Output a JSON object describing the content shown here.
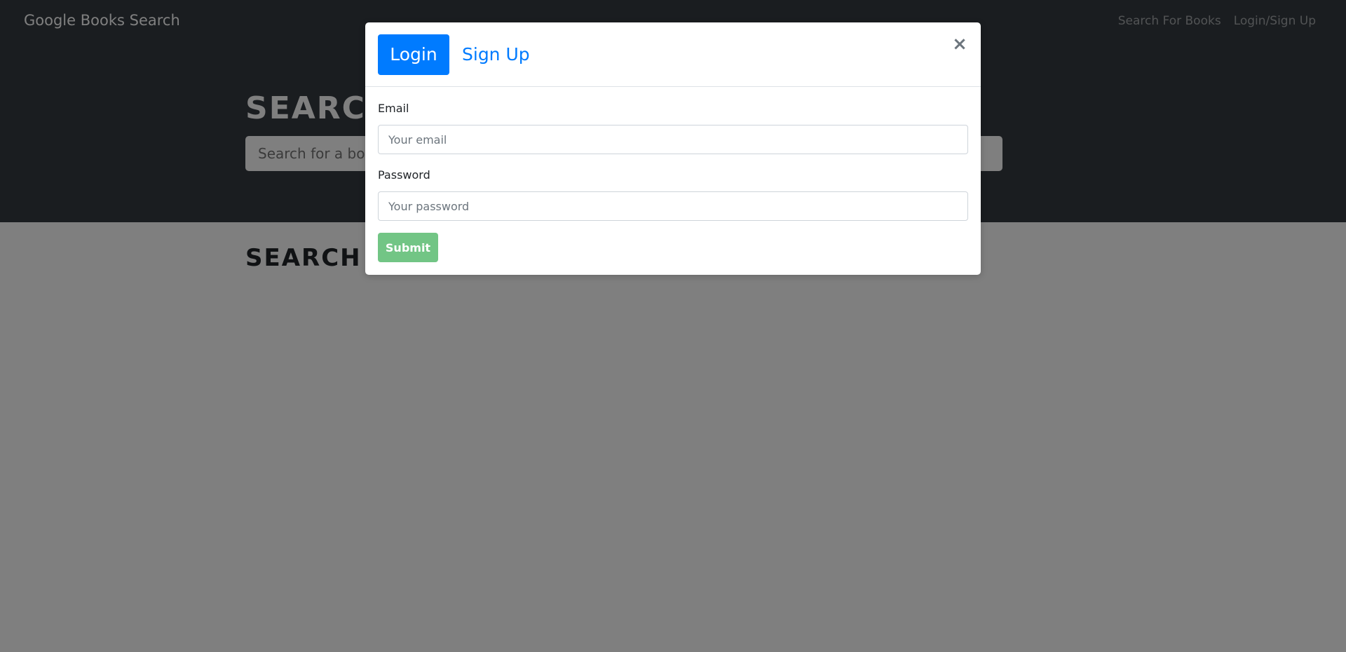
{
  "navbar": {
    "brand": "Google Books Search",
    "links": [
      "Search For Books",
      "Login/Sign Up"
    ]
  },
  "hero": {
    "title": "SEARCH FOR BOOKS!",
    "search_placeholder": "Search for a book"
  },
  "results": {
    "title": "SEARCH FOR A BOOK TO BEGIN"
  },
  "modal": {
    "tabs": {
      "login": "Login",
      "signup": "Sign Up"
    },
    "close_glyph": "×",
    "email_label": "Email",
    "email_placeholder": "Your email",
    "password_label": "Password",
    "password_placeholder": "Your password",
    "submit_label": "Submit"
  },
  "colors": {
    "navbar_bg": "#343a40",
    "primary": "#007bff",
    "success": "#28a745",
    "backdrop": "rgba(0,0,0,0.5)"
  }
}
